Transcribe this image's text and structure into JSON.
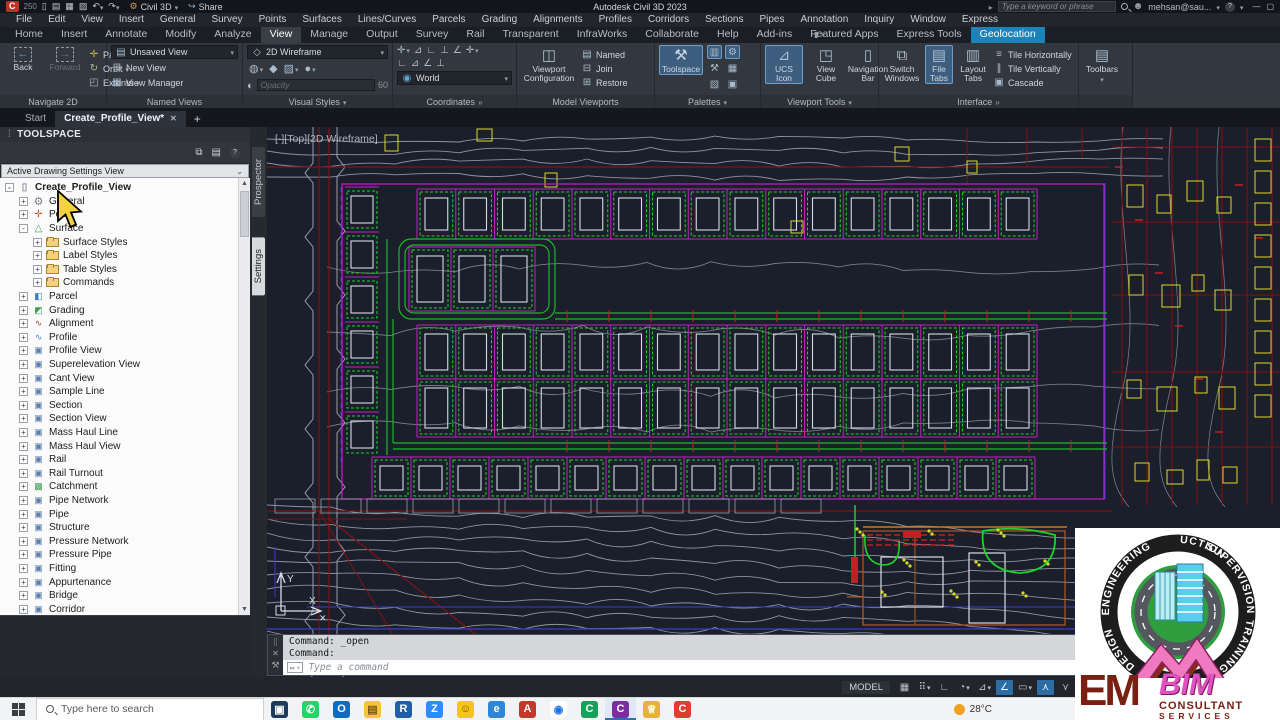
{
  "titlebar": {
    "badge": "C",
    "badge_num": "250",
    "workspace": "Civil 3D",
    "share": "Share",
    "title": "Autodesk Civil 3D 2023",
    "search_placeholder": "Type a keyword or phrase",
    "user": "mehsan@sau...",
    "qat": [
      {
        "g": "▯",
        "name": "new-file-icon"
      },
      {
        "g": "▤",
        "name": "open-icon"
      },
      {
        "g": "▦",
        "name": "save-icon"
      },
      {
        "g": "▨",
        "name": "plot-icon"
      },
      {
        "g": "↶",
        "name": "undo-icon",
        "dd": 1
      },
      {
        "g": "↷",
        "name": "redo-icon",
        "dd": 1
      }
    ]
  },
  "menubar": {
    "items": [
      "File",
      "Edit",
      "View",
      "Insert",
      "General",
      "Survey",
      "Points",
      "Surfaces",
      "Lines/Curves",
      "Parcels",
      "Grading",
      "Alignments",
      "Profiles",
      "Corridors",
      "Sections",
      "Pipes",
      "Annotation",
      "Inquiry",
      "Window",
      "Express"
    ]
  },
  "ribbon_tabs": {
    "items": [
      {
        "label": "Home"
      },
      {
        "label": "Insert"
      },
      {
        "label": "Annotate"
      },
      {
        "label": "Modify"
      },
      {
        "label": "Analyze"
      },
      {
        "label": "View",
        "cls": "active"
      },
      {
        "label": "Manage"
      },
      {
        "label": "Output"
      },
      {
        "label": "Survey"
      },
      {
        "label": "Rail"
      },
      {
        "label": "Transparent"
      },
      {
        "label": "InfraWorks"
      },
      {
        "label": "Collaborate"
      },
      {
        "label": "Help"
      },
      {
        "label": "Add-ins"
      },
      {
        "label": "Featured Apps"
      },
      {
        "label": "Express Tools"
      },
      {
        "label": "Geolocation",
        "cls": "geo"
      }
    ]
  },
  "ribbon": {
    "panels": [
      {
        "label": "Navigate 2D"
      },
      {
        "label": "Named Views"
      },
      {
        "label": "Visual Styles"
      },
      {
        "label": "Coordinates"
      },
      {
        "label": "Model Viewports"
      },
      {
        "label": "Palettes"
      },
      {
        "label": "Viewport Tools"
      },
      {
        "label": "Interface"
      },
      {
        "label": ""
      }
    ],
    "navigate": {
      "back": "Back",
      "forward": "Forward",
      "pan": "Pan",
      "orbit": "Orbit",
      "extents": "Extents"
    },
    "named_views": {
      "dropdown": "Unsaved View",
      "new_view": "New View",
      "view_manager": "View Manager"
    },
    "visual_styles": {
      "dropdown": "2D Wireframe",
      "opacity": "Opacity",
      "opacity_value": "60",
      "tools": [
        {
          "g": "◍",
          "dd": 1,
          "name": "face-style-icon"
        },
        {
          "g": "◆",
          "name": "shaded-icon"
        },
        {
          "g": "▨",
          "dd": 1,
          "name": "edge-style-icon"
        },
        {
          "g": "●",
          "dd": 1,
          "name": "material-icon"
        }
      ]
    },
    "coordinates": {
      "dropdown": "World",
      "tools": [
        {
          "g": "✛",
          "dd": 1,
          "name": "ucs-icon"
        },
        {
          "g": "⊿",
          "name": "ucs-3point-icon"
        },
        {
          "g": "∟",
          "name": "ucs-z-icon"
        },
        {
          "g": "⊥",
          "name": "ucs-face-icon"
        },
        {
          "g": "∠",
          "name": "ucs-view-icon"
        },
        {
          "g": "✛",
          "dd": 1,
          "name": "ucs-origin-icon"
        },
        {
          "g": "∟",
          "name": "ucs-x-icon"
        },
        {
          "g": "⊿",
          "name": "ucs-y-icon"
        },
        {
          "g": "∠",
          "name": "ucs-named-icon"
        },
        {
          "g": "⊥",
          "name": "ucs-object-icon"
        }
      ]
    },
    "model_viewports": {
      "config": "Viewport Configuration",
      "named": "Named",
      "join": "Join",
      "restore": "Restore"
    },
    "palettes": {
      "toolspace": "Toolspace",
      "tools": [
        {
          "g": "▥",
          "hl": 1,
          "name": "properties-palette-icon"
        },
        {
          "g": "⚙",
          "hl": 1,
          "name": "settings-palette-icon"
        },
        {
          "g": "⚒",
          "name": "tool-palettes-icon"
        },
        {
          "g": "▦",
          "name": "sheet-set-icon"
        },
        {
          "g": "▧",
          "name": "survey-palette-icon"
        },
        {
          "g": "▣",
          "name": "design-center-icon"
        }
      ]
    },
    "viewport_tools": {
      "ucs": "UCS Icon",
      "cube": "View Cube",
      "navbar": "Navigation Bar"
    },
    "interface": {
      "switch": "Switch Windows",
      "file_tabs": "File Tabs",
      "layout_tabs": "Layout Tabs",
      "tile_h": "Tile Horizontally",
      "tile_v": "Tile Vertically",
      "cascade": "Cascade"
    },
    "toolbars": "Toolbars"
  },
  "file_tabs": {
    "start": "Start",
    "active": "Create_Profile_View*"
  },
  "toolspace": {
    "title": "TOOLSPACE",
    "dropdown": "Active Drawing Settings View",
    "tabs": [
      {
        "label": "Prospector"
      },
      {
        "label": "Settings",
        "cls": "active"
      }
    ],
    "tree": [
      {
        "label": "Create_Profile_View",
        "lvl": 0,
        "exp": "-",
        "icon": "drawing",
        "cls": "root"
      },
      {
        "label": "General",
        "lvl": 1,
        "exp": "+",
        "icon": "gear"
      },
      {
        "label": "Point",
        "lvl": 1,
        "exp": "+",
        "icon": "point"
      },
      {
        "label": "Surface",
        "lvl": 1,
        "exp": "-",
        "icon": "surface"
      },
      {
        "label": "Surface Styles",
        "lvl": 2,
        "exp": "+",
        "icon": "folder"
      },
      {
        "label": "Label Styles",
        "lvl": 2,
        "exp": "+",
        "icon": "folder"
      },
      {
        "label": "Table Styles",
        "lvl": 2,
        "exp": "+",
        "icon": "folder"
      },
      {
        "label": "Commands",
        "lvl": 2,
        "exp": "+",
        "icon": "folder"
      },
      {
        "label": "Parcel",
        "lvl": 1,
        "exp": "+",
        "icon": "parcel"
      },
      {
        "label": "Grading",
        "lvl": 1,
        "exp": "+",
        "icon": "grading"
      },
      {
        "label": "Alignment",
        "lvl": 1,
        "exp": "+",
        "icon": "alignment"
      },
      {
        "label": "Profile",
        "lvl": 1,
        "exp": "+",
        "icon": "profile"
      },
      {
        "label": "Profile View",
        "lvl": 1,
        "exp": "+",
        "icon": "profile-view"
      },
      {
        "label": "Superelevation View",
        "lvl": 1,
        "exp": "+",
        "icon": "superelevation-view"
      },
      {
        "label": "Cant View",
        "lvl": 1,
        "exp": "+",
        "icon": "cant-view"
      },
      {
        "label": "Sample Line",
        "lvl": 1,
        "exp": "+",
        "icon": "sample-line"
      },
      {
        "label": "Section",
        "lvl": 1,
        "exp": "+",
        "icon": "section"
      },
      {
        "label": "Section View",
        "lvl": 1,
        "exp": "+",
        "icon": "section-view"
      },
      {
        "label": "Mass Haul Line",
        "lvl": 1,
        "exp": "+",
        "icon": "mass-haul-line"
      },
      {
        "label": "Mass Haul View",
        "lvl": 1,
        "exp": "+",
        "icon": "mass-haul-view"
      },
      {
        "label": "Rail",
        "lvl": 1,
        "exp": "+",
        "icon": "rail"
      },
      {
        "label": "Rail Turnout",
        "lvl": 1,
        "exp": "+",
        "icon": "rail-turnout"
      },
      {
        "label": "Catchment",
        "lvl": 1,
        "exp": "+",
        "icon": "catchment"
      },
      {
        "label": "Pipe Network",
        "lvl": 1,
        "exp": "+",
        "icon": "pipe-network"
      },
      {
        "label": "Pipe",
        "lvl": 1,
        "exp": "+",
        "icon": "pipe"
      },
      {
        "label": "Structure",
        "lvl": 1,
        "exp": "+",
        "icon": "structure"
      },
      {
        "label": "Pressure Network",
        "lvl": 1,
        "exp": "+",
        "icon": "pressure-network"
      },
      {
        "label": "Pressure Pipe",
        "lvl": 1,
        "exp": "+",
        "icon": "pressure-pipe"
      },
      {
        "label": "Fitting",
        "lvl": 1,
        "exp": "+",
        "icon": "fitting"
      },
      {
        "label": "Appurtenance",
        "lvl": 1,
        "exp": "+",
        "icon": "appurtenance"
      },
      {
        "label": "Bridge",
        "lvl": 1,
        "exp": "+",
        "icon": "bridge"
      },
      {
        "label": "Corridor",
        "lvl": 1,
        "exp": "+",
        "icon": "corridor"
      }
    ]
  },
  "viewport": {
    "label": "[-][Top][2D Wireframe]"
  },
  "command": {
    "history": [
      "Command: _open",
      "Command:"
    ],
    "placeholder": "Type a command"
  },
  "statusbar": {
    "model": "MODEL",
    "icons": [
      {
        "g": "▦",
        "name": "grid-icon"
      },
      {
        "g": "⠿",
        "name": "snap-icon",
        "dd": 1
      },
      {
        "g": "∟",
        "name": "ortho-icon"
      },
      {
        "g": "◔",
        "name": "polar-tracking-icon",
        "dd": 1
      },
      {
        "g": "⊿",
        "name": "isodraft-icon",
        "dd": 1
      },
      {
        "g": "∠",
        "name": "osnap-icon",
        "hl": 1
      },
      {
        "g": "▭",
        "name": "object-snap-icon",
        "dd": 1
      },
      {
        "g": "⋏",
        "name": "annotation-monitor-icon",
        "hl": 1
      },
      {
        "g": "⋎",
        "name": "annotation-scale-icon"
      }
    ]
  },
  "taskbar": {
    "search_placeholder": "Type here to search",
    "temp": "28°C",
    "icons": [
      {
        "g": "▣",
        "bg": "#1b3a5c",
        "name": "microsoft-store-icon"
      },
      {
        "g": "✆",
        "bg": "#25d366",
        "name": "whatsapp-icon"
      },
      {
        "g": "O",
        "bg": "#0f6cbd",
        "name": "outlook-icon"
      },
      {
        "g": "▤",
        "bg": "#f8c33a",
        "fg": "#7a5b10",
        "name": "file-explorer-icon"
      },
      {
        "g": "R",
        "bg": "#1f5fa8",
        "name": "revit-icon"
      },
      {
        "g": "Z",
        "bg": "#2d8cff",
        "name": "zoom-icon"
      },
      {
        "g": "☺",
        "bg": "#f5c518",
        "fg": "#7a4a00",
        "name": "emoji-icon"
      },
      {
        "g": "e",
        "bg": "#2f86d6",
        "name": "edge-icon"
      },
      {
        "g": "A",
        "bg": "#c0392b",
        "name": "autocad-icon"
      },
      {
        "g": "◉",
        "bg": "#ffffff",
        "fg": "#1a73e8",
        "name": "chrome-icon"
      },
      {
        "g": "C",
        "bg": "#16a05a",
        "name": "camtasia-icon"
      },
      {
        "g": "C",
        "bg": "#7a2ea0",
        "active": 1,
        "name": "civil3d-icon"
      },
      {
        "g": "♕",
        "bg": "#e8b23a",
        "name": "trophy-icon"
      },
      {
        "g": "C",
        "bg": "#e03c31",
        "name": "autocad-red-icon"
      }
    ]
  },
  "logo": {
    "arc_words": [
      "CONSTRUCTION",
      "SUPERVISION",
      "TRAINING",
      "DESIGN",
      "ENGINEERING"
    ],
    "em": "EM",
    "bim": "BIM",
    "line2": "CONSULTANT",
    "line3": "SERVICES"
  },
  "drawing": {
    "colors": {
      "contour": "#8d93a0",
      "contour2": "#767c88",
      "magenta": "#c21fc2",
      "green": "#1db829",
      "greenDash": "#1ed32a",
      "building": "#d7dbe2",
      "yellow": "#d9d92a",
      "darkRed": "#871212",
      "red": "#c32121",
      "navy": "#3a3ad0",
      "brown": "#b05a1e",
      "roadGray": "#9aa0ab",
      "white": "#d9dde4",
      "orange": "#d07818"
    }
  }
}
